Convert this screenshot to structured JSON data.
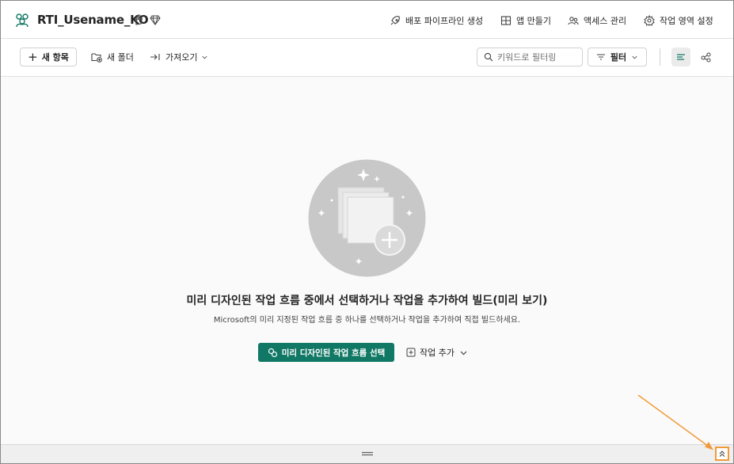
{
  "header": {
    "workspace_title": "RTI_Usename_KO",
    "actions": [
      {
        "label": "배포 파이프라인 생성",
        "icon": "rocket-icon"
      },
      {
        "label": "앱 만들기",
        "icon": "app-grid-icon"
      },
      {
        "label": "액세스 관리",
        "icon": "people-icon"
      },
      {
        "label": "작업 영역 설정",
        "icon": "gear-icon"
      }
    ]
  },
  "toolbar": {
    "new_item_label": "새 항목",
    "new_folder_label": "새 폴더",
    "import_label": "가져오기",
    "search_placeholder": "키워드로 필터링",
    "filter_label": "필터"
  },
  "empty_state": {
    "title": "미리 디자인된 작업 흐름 중에서 선택하거나 작업을 추가하여 빌드(미리 보기)",
    "subtitle": "Microsoft의 미리 지정된 작업 흐름 중 하나를 선택하거나 작업을 추가하여 직접 빌드하세요.",
    "primary_button": "미리 디자인된 작업 흐름 선택",
    "secondary_button": "작업 추가"
  },
  "colors": {
    "primary": "#117865",
    "annotation": "#f29a38",
    "illustration_bg": "#c8c8c8"
  }
}
